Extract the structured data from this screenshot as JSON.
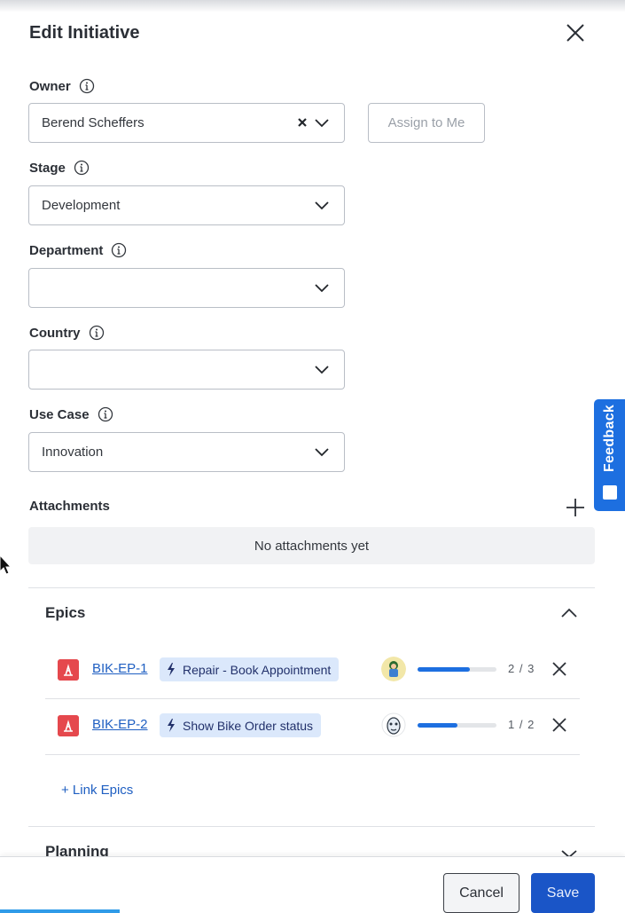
{
  "dialog": {
    "title": "Edit Initiative"
  },
  "owner": {
    "label": "Owner",
    "value": "Berend Scheffers",
    "assign_label": "Assign to Me"
  },
  "stage": {
    "label": "Stage",
    "value": "Development"
  },
  "department": {
    "label": "Department",
    "value": ""
  },
  "country": {
    "label": "Country",
    "value": ""
  },
  "use_case": {
    "label": "Use Case",
    "value": "Innovation"
  },
  "feedback": {
    "label": "Feedback"
  },
  "attachments": {
    "label": "Attachments",
    "empty_text": "No attachments yet"
  },
  "epics": {
    "title": "Epics",
    "items": [
      {
        "key": "BIK-EP-1",
        "name": "Repair - Book Appointment",
        "done": 2,
        "total": 3,
        "progress_text": "2 / 3"
      },
      {
        "key": "BIK-EP-2",
        "name": "Show Bike Order status",
        "done": 1,
        "total": 2,
        "progress_text": "1 / 2"
      }
    ],
    "link_label": "+ Link Epics"
  },
  "planning": {
    "title": "Planning"
  },
  "footer": {
    "cancel_label": "Cancel",
    "save_label": "Save"
  },
  "colors": {
    "accent": "#1d6fe0",
    "save": "#1a55c7",
    "epic_icon": "#e5484d",
    "chip": "#dbe8fb"
  },
  "icons": [
    "close-icon",
    "info-icon",
    "chevron-down-icon",
    "clear-icon",
    "plus-icon",
    "chevron-up-icon",
    "bolt-icon",
    "epic-icon"
  ]
}
